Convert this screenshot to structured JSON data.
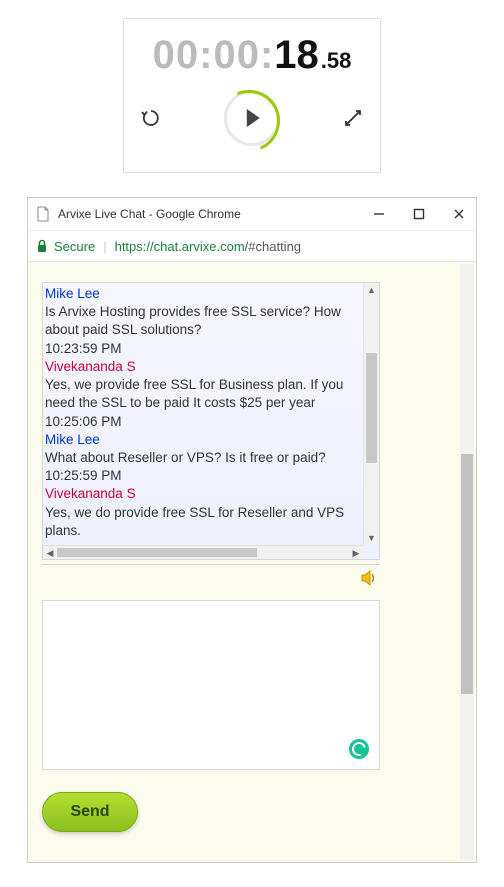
{
  "stopwatch": {
    "gray": "00:00:",
    "main": "18",
    "frac": ".58"
  },
  "window": {
    "title": "Arvixe Live Chat - Google Chrome"
  },
  "address": {
    "secure_label": "Secure",
    "url_host": "https://chat.arvixe.com",
    "url_path": "/#chatting"
  },
  "chat": {
    "messages": [
      {
        "name": "Mike Lee",
        "name_class": "name-mike",
        "text": "Is Arvixe Hosting provides free SSL service? How about paid SSL solutions?",
        "time": "10:23:59 PM"
      },
      {
        "name": "Vivekananda S",
        "name_class": "name-viv",
        "text": "Yes, we provide free SSL for Business plan. If you need the SSL to be paid It costs $25 per year",
        "time": "10:25:06 PM"
      },
      {
        "name": "Mike Lee",
        "name_class": "name-mike",
        "text": "What about Reseller or VPS? Is it free or paid?",
        "time": "10:25:59 PM"
      },
      {
        "name": "Vivekananda S",
        "name_class": "name-viv",
        "text": "Yes, we do provide free SSL for Reseller and VPS plans.",
        "time": ""
      }
    ]
  },
  "compose": {
    "placeholder": "",
    "value": "",
    "send_label": "Send"
  }
}
